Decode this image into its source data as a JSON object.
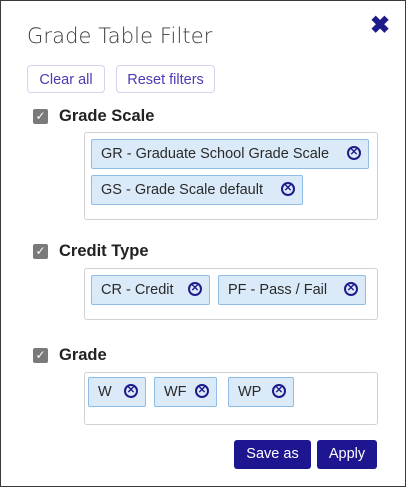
{
  "dialog": {
    "title": "Grade Table Filter",
    "close_icon": "close-icon"
  },
  "toolbar": {
    "clear_all": "Clear all",
    "reset_filters": "Reset filters"
  },
  "sections": [
    {
      "title": "Grade Scale",
      "checked": true,
      "chips": [
        "GR - Graduate School Grade Scale",
        "GS - Grade Scale default"
      ]
    },
    {
      "title": "Credit Type",
      "checked": true,
      "chips": [
        "CR - Credit",
        "PF - Pass / Fail"
      ]
    },
    {
      "title": "Grade",
      "checked": true,
      "chips": [
        "W",
        "WF",
        "WP"
      ]
    }
  ],
  "footer": {
    "save_as": "Save as",
    "apply": "Apply"
  },
  "colors": {
    "primary": "#1e1591",
    "chip_bg": "#dbeaf9",
    "chip_border": "#8fbde6",
    "link": "#4d3bb5"
  }
}
